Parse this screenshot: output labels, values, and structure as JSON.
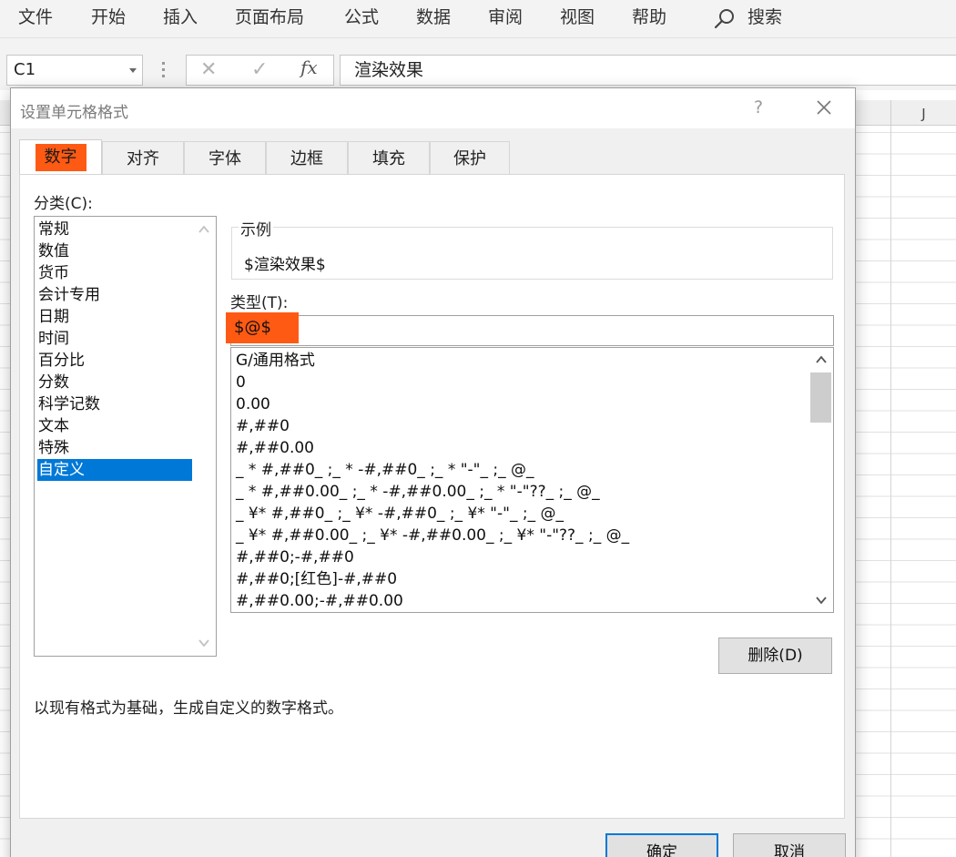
{
  "ribbon": {
    "menu": [
      "文件",
      "开始",
      "插入",
      "页面布局",
      "公式",
      "数据",
      "审阅",
      "视图",
      "帮助"
    ],
    "search_label": "搜索"
  },
  "formula_bar": {
    "name_box": "C1",
    "fx_label": "fx",
    "cancel_glyph": "✕",
    "enter_glyph": "✓",
    "content": "渲染效果"
  },
  "sheet": {
    "visible_column": "J"
  },
  "dialog": {
    "title": "设置单元格格式",
    "help": "?",
    "tabs": [
      "数字",
      "对齐",
      "字体",
      "边框",
      "填充",
      "保护"
    ],
    "active_tab": "数字",
    "category_label": "分类(C):",
    "categories": [
      "常规",
      "数值",
      "货币",
      "会计专用",
      "日期",
      "时间",
      "百分比",
      "分数",
      "科学记数",
      "文本",
      "特殊",
      "自定义"
    ],
    "selected_category": "自定义",
    "sample_legend": "示例",
    "sample_value": "$渲染效果$",
    "type_label": "类型(T):",
    "type_value": "$@$",
    "formats": [
      "G/通用格式",
      "0",
      "0.00",
      "#,##0",
      "#,##0.00",
      "_ * #,##0_ ;_ * -#,##0_ ;_ * \"-\"_ ;_ @_",
      "_ * #,##0.00_ ;_ * -#,##0.00_ ;_ * \"-\"??_ ;_ @_",
      "_ ¥* #,##0_ ;_ ¥* -#,##0_ ;_ ¥* \"-\"_ ;_ @_",
      "_ ¥* #,##0.00_ ;_ ¥* -#,##0.00_ ;_ ¥* \"-\"??_ ;_ @_",
      "#,##0;-#,##0",
      "#,##0;[红色]-#,##0",
      "#,##0.00;-#,##0.00"
    ],
    "delete_button": "删除(D)",
    "description": "以现有格式为基础，生成自定义的数字格式。",
    "ok_button": "确定",
    "cancel_button": "取消"
  },
  "colors": {
    "highlight": "#ff5a14",
    "selection": "#0078d7"
  }
}
